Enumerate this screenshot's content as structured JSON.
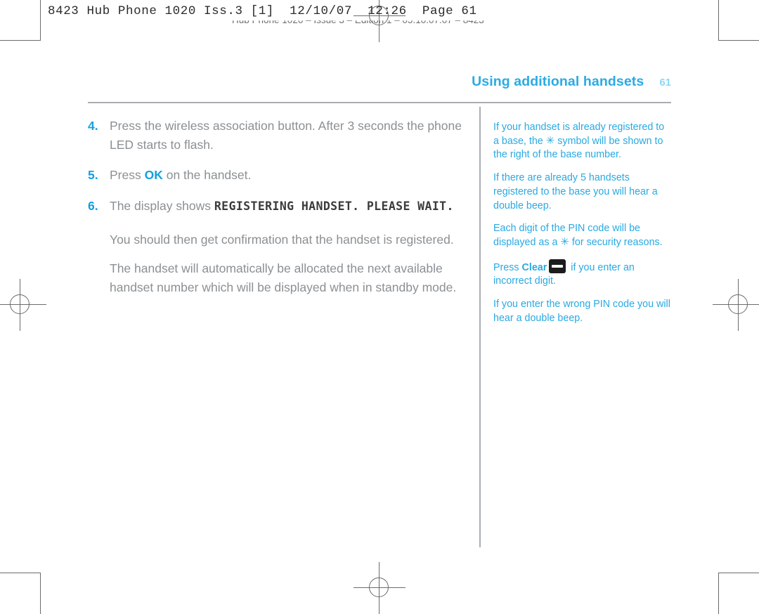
{
  "prepress": {
    "slug": "8423 Hub Phone 1020 Iss.3 [1]  12/10/07  12:26  Page 61",
    "footline": "Hub Phone 1020 – Issue 3 – Edition 1 – 05.10.07.07 – 8423"
  },
  "colors": {
    "heading_blue": "#2aabe4",
    "accent_blue": "#13a0e0",
    "note_blue": "#29a9e2",
    "folio_blue": "#8fd6f2",
    "body_gray": "#8b9094",
    "rule_gray": "#a9adb2",
    "lcd_text": "#3b3b3b",
    "keycap_dark": "#1c1c1c"
  },
  "running_head": {
    "title": "Using additional handsets",
    "folio": "61"
  },
  "main_column": {
    "steps": [
      {
        "number": "4.",
        "text": "Press the wireless association button. After 3 seconds the phone LED starts to flash."
      },
      {
        "number": "5.",
        "text_before": "Press ",
        "accent": "OK",
        "text_after": " on the handset."
      },
      {
        "number": "6.",
        "text_before": "The display shows ",
        "lcd": "REGISTERING HANDSET. PLEASE WAIT."
      }
    ],
    "paragraphs": [
      "You should then get confirmation that the handset is registered.",
      "The handset will automatically be allocated the next available handset number which will be displayed when in standby mode."
    ]
  },
  "side_notes": [
    {
      "part1": "If your handset is already registered to a base, the ",
      "symbol": "✳",
      "part2": " symbol will be shown to the right of the base number."
    },
    {
      "part1": "If there are already 5 handsets registered to the base you will hear a double beep."
    },
    {
      "part1": "Each digit of the PIN code will be displayed as a ",
      "symbol": "✳",
      "part2": " for security reasons."
    },
    {
      "part1": "Press ",
      "bold": "Clear",
      "keycap": "clear-key",
      "part2": " if you enter an incorrect digit."
    },
    {
      "part1": "If you enter the wrong PIN code you will hear a double beep."
    }
  ]
}
